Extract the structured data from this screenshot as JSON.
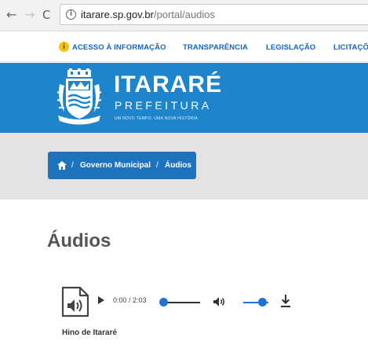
{
  "browser": {
    "back_glyph": "←",
    "forward_glyph": "→",
    "reload_glyph": "C",
    "url_host": "itarare.sp.gov.br",
    "url_path": "/portal/audios"
  },
  "top_links": [
    {
      "label": "ACESSO À INFORMAÇÃO"
    },
    {
      "label": "TRANSPARÊNCIA"
    },
    {
      "label": "LEGISLAÇÃO"
    },
    {
      "label": "LICITAÇÕ"
    }
  ],
  "colors": {
    "header_blue": "#1e84cb",
    "breadcrumb_blue": "#1e73be",
    "accent_yellow": "#f5c400"
  },
  "brand": {
    "title": "ITARARÉ",
    "subtitle": "PREFEITURA",
    "tagline": "UM NOVO TEMPO, UMA NOVA HISTÓRIA"
  },
  "breadcrumb": {
    "items": [
      "Governo Municipal",
      "Áudios"
    ],
    "separator": "/"
  },
  "page": {
    "title": "Áudios"
  },
  "audio": {
    "time": "0:00 / 2:03",
    "title": "Hino de Itararé"
  },
  "icons": {
    "info": "info-icon",
    "home": "home-icon",
    "play": "play-icon",
    "volume": "volume-icon",
    "download": "download-icon",
    "audio_file": "audio-file-icon"
  }
}
